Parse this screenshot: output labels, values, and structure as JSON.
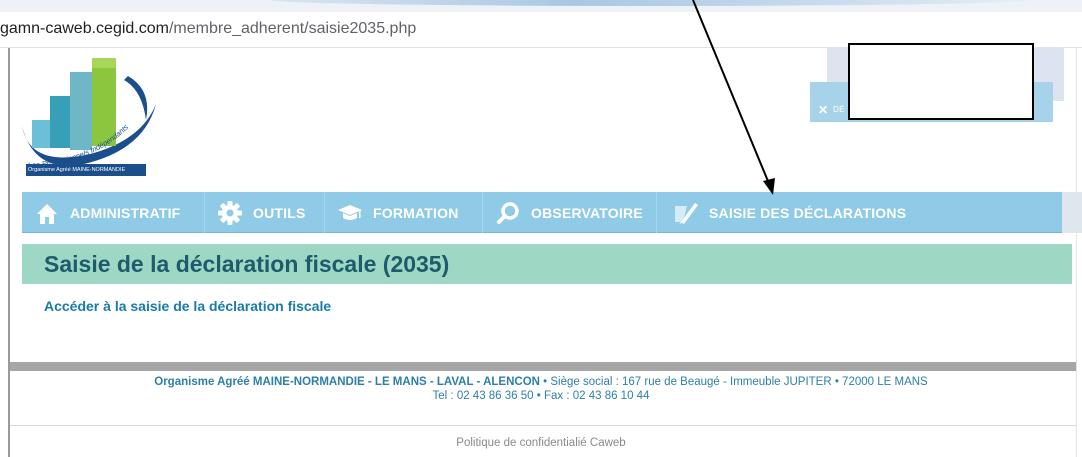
{
  "browser": {
    "url_host": "gamn-caweb.cegid.com",
    "url_path": "/membre_adherent/saisie2035.php"
  },
  "logo": {
    "arc_text": "Les Professionnels Indépendants",
    "band_text": "Organisme Agréé MAINE-NORMANDIE"
  },
  "top_right": {
    "tab_label": "DÉ",
    "close_glyph": "✕"
  },
  "nav": {
    "items": [
      {
        "label": "ADMINISTRATIF",
        "icon": "home-icon"
      },
      {
        "label": "OUTILS",
        "icon": "gear-icon"
      },
      {
        "label": "FORMATION",
        "icon": "graduation-cap-icon"
      },
      {
        "label": "OBSERVATOIRE",
        "icon": "magnifier-icon"
      },
      {
        "label": "SAISIE DES DÉCLARATIONS",
        "icon": "pen-paper-icon"
      }
    ]
  },
  "main": {
    "title": "Saisie de la déclaration fiscale (2035)",
    "access_link": "Accéder à la saisie de la déclaration fiscale"
  },
  "footer": {
    "org_name": "Organisme Agréé MAINE-NORMANDIE - LE MANS - LAVAL - ALENCON",
    "address": " • Siège social : 167 rue de Beaugé - Immeuble JUPITER • 72000 LE MANS",
    "contact": "Tel : 02 43 86 36 50 • Fax : 02 43 86 10 44",
    "privacy_link": "Politique de confidentialié Caweb"
  },
  "colors": {
    "nav_bg": "#8fcbe6",
    "title_band_bg": "#9fd7c5",
    "title_text": "#1e5b6b",
    "link_blue": "#1b7ba8",
    "footer_text": "#2d7fa6"
  }
}
